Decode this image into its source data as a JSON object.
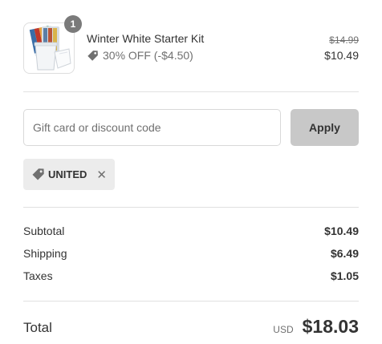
{
  "line_item": {
    "quantity": "1",
    "title": "Winter White Starter Kit",
    "discount": "30% OFF (-$4.50)",
    "compare_price": "$14.99",
    "price": "$10.49"
  },
  "discount_form": {
    "placeholder": "Gift card or discount code",
    "value": "",
    "apply_label": "Apply"
  },
  "applied_code": {
    "code": "UNITED",
    "remove_icon": "close-icon"
  },
  "summary": {
    "subtotal_label": "Subtotal",
    "subtotal_value": "$10.49",
    "shipping_label": "Shipping",
    "shipping_value": "$6.49",
    "taxes_label": "Taxes",
    "taxes_value": "$1.05"
  },
  "total": {
    "label": "Total",
    "currency": "USD",
    "amount": "$18.03"
  },
  "colors": {
    "apply_button_bg": "#c8c8c8",
    "chip_bg": "#ececec",
    "badge_bg": "#7a7a7a",
    "muted_text": "#707070"
  }
}
